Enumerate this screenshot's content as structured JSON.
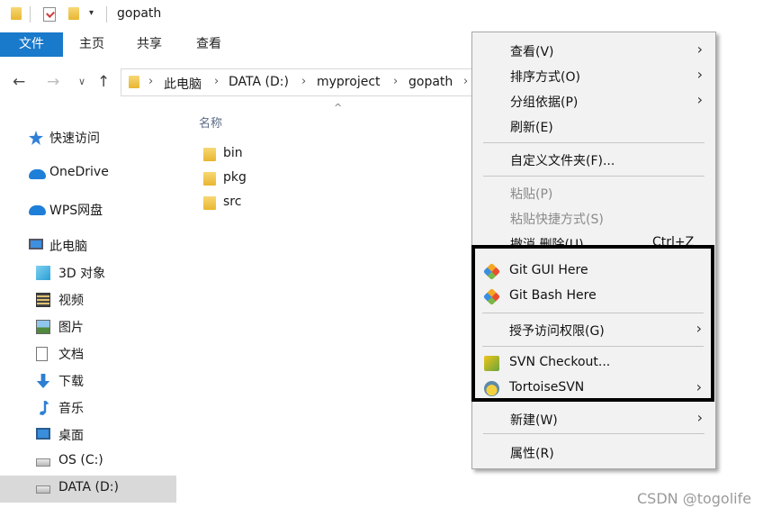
{
  "window": {
    "title": "gopath"
  },
  "quick_access_toolbar": {
    "dropdown_glyph": "▾"
  },
  "ribbon": {
    "tabs": [
      "文件",
      "主页",
      "共享",
      "查看"
    ]
  },
  "nav": {
    "back_glyph": "←",
    "forward_glyph": "→",
    "recent_glyph": "∨",
    "up_glyph": "↑"
  },
  "breadcrumb": [
    "此电脑",
    "DATA (D:)",
    "myproject",
    "gopath"
  ],
  "breadcrumb_separator": "›",
  "nav_pane": {
    "items": [
      {
        "label": "快速访问",
        "icon": "star-icon"
      },
      {
        "label": "OneDrive",
        "icon": "cloud-icon"
      },
      {
        "label": "WPS网盘",
        "icon": "cloud-icon"
      },
      {
        "label": "此电脑",
        "icon": "computer-icon"
      },
      {
        "label": "3D 对象",
        "icon": "cube-icon"
      },
      {
        "label": "视频",
        "icon": "film-icon"
      },
      {
        "label": "图片",
        "icon": "picture-icon"
      },
      {
        "label": "文档",
        "icon": "document-icon"
      },
      {
        "label": "下载",
        "icon": "download-icon"
      },
      {
        "label": "音乐",
        "icon": "music-icon"
      },
      {
        "label": "桌面",
        "icon": "desktop-icon"
      },
      {
        "label": "OS (C:)",
        "icon": "drive-icon"
      },
      {
        "label": "DATA (D:)",
        "icon": "drive-icon"
      }
    ],
    "selected": "DATA (D:)"
  },
  "file_list": {
    "column_header": "名称",
    "sort_glyph": "^",
    "items": [
      "bin",
      "pkg",
      "src"
    ]
  },
  "context_menu": {
    "items": [
      {
        "label": "查看(V)",
        "submenu": true
      },
      {
        "label": "排序方式(O)",
        "submenu": true
      },
      {
        "label": "分组依据(P)",
        "submenu": true
      },
      {
        "label": "刷新(E)"
      },
      {
        "label": "自定义文件夹(F)..."
      },
      {
        "label": "粘贴(P)",
        "disabled": true
      },
      {
        "label": "粘贴快捷方式(S)",
        "disabled": true
      },
      {
        "label": "撤消 删除(U)",
        "shortcut": "Ctrl+Z"
      },
      {
        "label": "Git GUI Here",
        "icon": "git-icon"
      },
      {
        "label": "Git Bash Here",
        "icon": "git-icon"
      },
      {
        "label": "授予访问权限(G)",
        "submenu": true
      },
      {
        "label": "SVN Checkout...",
        "icon": "svn-checkout-icon"
      },
      {
        "label": "TortoiseSVN",
        "icon": "tortoisesvn-icon",
        "submenu": true
      },
      {
        "label": "新建(W)",
        "submenu": true
      },
      {
        "label": "属性(R)"
      }
    ],
    "arrow_glyph": "›"
  },
  "watermark": "CSDN @togolife",
  "colors": {
    "accent": "#1979ca",
    "menu_bg": "#f2f2f2",
    "highlight_border": "#000000"
  }
}
